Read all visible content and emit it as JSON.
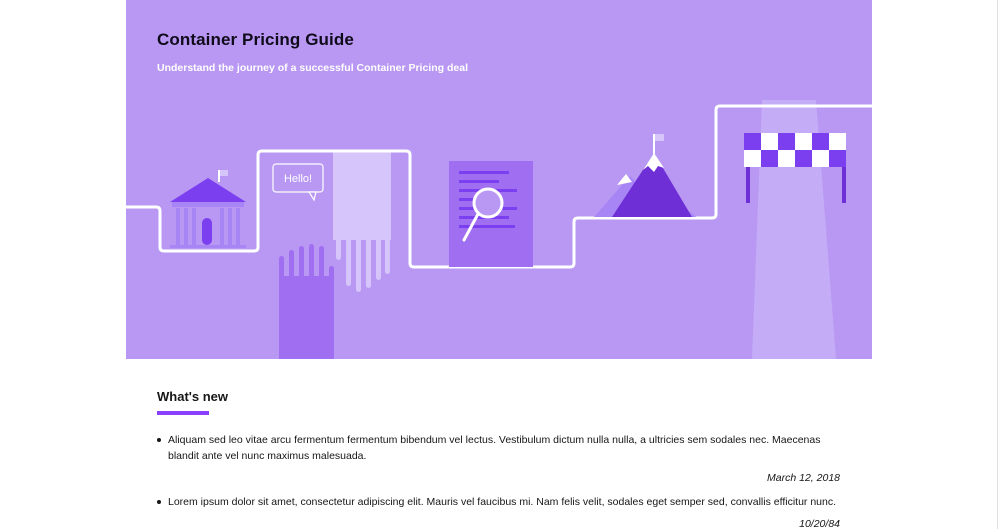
{
  "hero": {
    "title": "Container Pricing Guide",
    "subtitle": "Understand the journey of a successful Container Pricing deal",
    "speech_bubble": "Hello!",
    "background_color": "#b898f3",
    "accent_color": "#8a3ffc",
    "illustrations": [
      "bank-icon",
      "speech-bubble-icon",
      "handshake-icon",
      "document-magnifier-icon",
      "mountain-flag-icon",
      "finish-line-icon"
    ]
  },
  "whats_new": {
    "heading": "What's new",
    "items": [
      {
        "text": "Aliquam sed leo vitae arcu fermentum fermentum bibendum vel lectus. Vestibulum dictum nulla nulla, a ultricies sem sodales nec. Maecenas blandit ante vel nunc maximus malesuada.",
        "date": "March 12, 2018"
      },
      {
        "text": "Lorem ipsum dolor sit amet, consectetur adipiscing elit. Mauris vel faucibus mi. Nam felis velit, sodales eget semper sed, convallis efficitur nunc.",
        "date": "10/20/84"
      }
    ]
  }
}
